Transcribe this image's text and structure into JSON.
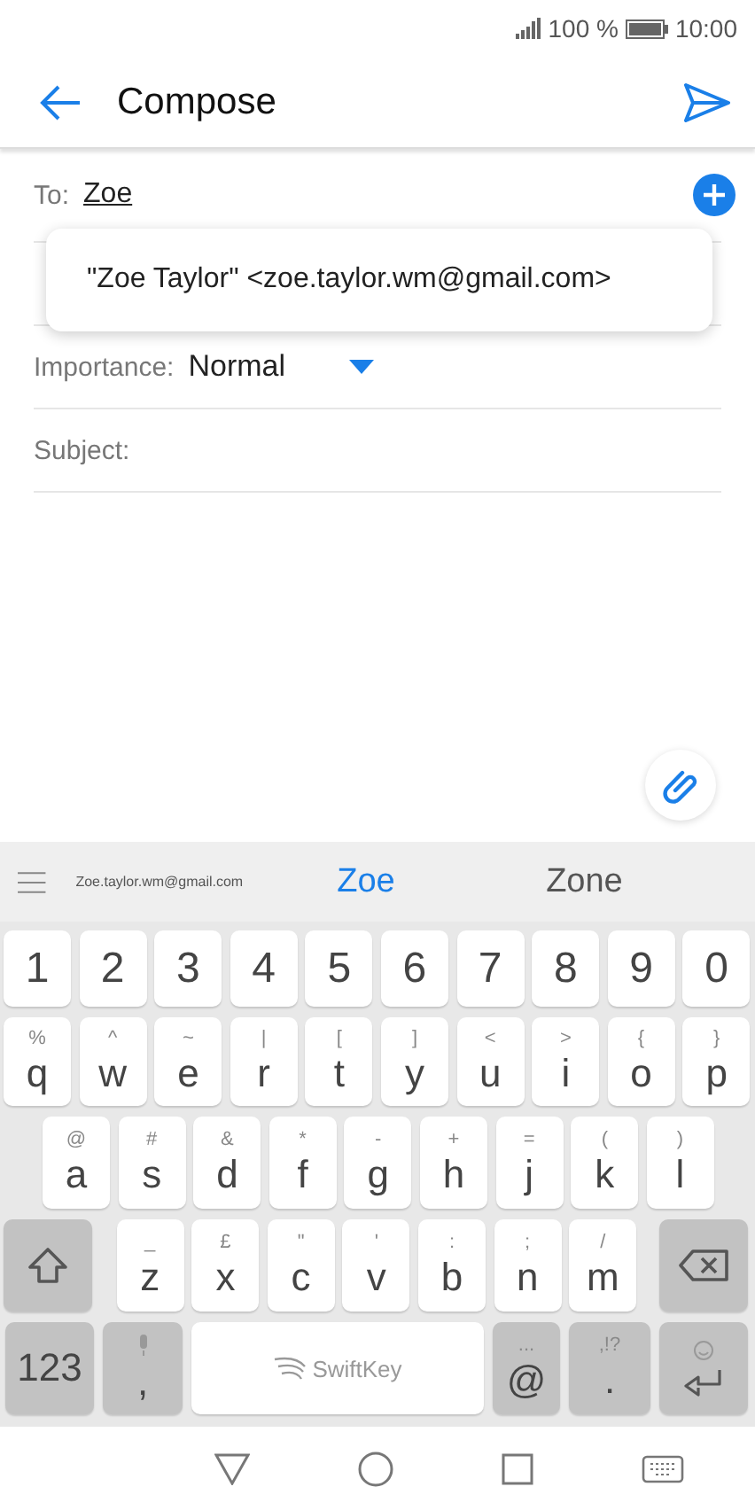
{
  "status_bar": {
    "battery": "100 %",
    "time": "10:00"
  },
  "app_bar": {
    "title": "Compose"
  },
  "to_field": {
    "label": "To:",
    "value": "Zoe"
  },
  "suggestion_popup": {
    "text": "\"Zoe Taylor\" <zoe.taylor.wm@gmail.com>"
  },
  "importance": {
    "label": "Importance:",
    "value": "Normal"
  },
  "subject": {
    "label": "Subject:"
  },
  "keyboard": {
    "suggestions": [
      {
        "text": "Zoe.taylor.wm@gmail.com",
        "kind": "small",
        "selected": false
      },
      {
        "text": "Zoe",
        "kind": "word",
        "selected": true
      },
      {
        "text": "Zone",
        "kind": "word",
        "selected": false
      }
    ],
    "rows": [
      {
        "keys": [
          {
            "kind": "char",
            "label": "1"
          },
          {
            "kind": "char",
            "label": "2"
          },
          {
            "kind": "char",
            "label": "3"
          },
          {
            "kind": "char",
            "label": "4"
          },
          {
            "kind": "char",
            "label": "5"
          },
          {
            "kind": "char",
            "label": "6"
          },
          {
            "kind": "char",
            "label": "7"
          },
          {
            "kind": "char",
            "label": "8"
          },
          {
            "kind": "char",
            "label": "9"
          },
          {
            "kind": "char",
            "label": "0"
          }
        ]
      },
      {
        "keys": [
          {
            "kind": "char",
            "label": "q",
            "hint": "%"
          },
          {
            "kind": "char",
            "label": "w",
            "hint": "^"
          },
          {
            "kind": "char",
            "label": "e",
            "hint": "~"
          },
          {
            "kind": "char",
            "label": "r",
            "hint": "|"
          },
          {
            "kind": "char",
            "label": "t",
            "hint": "["
          },
          {
            "kind": "char",
            "label": "y",
            "hint": "]"
          },
          {
            "kind": "char",
            "label": "u",
            "hint": "<"
          },
          {
            "kind": "char",
            "label": "i",
            "hint": ">"
          },
          {
            "kind": "char",
            "label": "o",
            "hint": "{"
          },
          {
            "kind": "char",
            "label": "p",
            "hint": "}"
          }
        ]
      },
      {
        "keys": [
          {
            "kind": "char",
            "label": "a",
            "hint": "@"
          },
          {
            "kind": "char",
            "label": "s",
            "hint": "#"
          },
          {
            "kind": "char",
            "label": "d",
            "hint": "&"
          },
          {
            "kind": "char",
            "label": "f",
            "hint": "*"
          },
          {
            "kind": "char",
            "label": "g",
            "hint": "-"
          },
          {
            "kind": "char",
            "label": "h",
            "hint": "+"
          },
          {
            "kind": "char",
            "label": "j",
            "hint": "="
          },
          {
            "kind": "char",
            "label": "k",
            "hint": "("
          },
          {
            "kind": "char",
            "label": "l",
            "hint": ")"
          }
        ]
      },
      {
        "keys": [
          {
            "kind": "shift"
          },
          {
            "kind": "char",
            "label": "z",
            "hint": "_"
          },
          {
            "kind": "char",
            "label": "x",
            "hint": "£"
          },
          {
            "kind": "char",
            "label": "c",
            "hint": "\""
          },
          {
            "kind": "char",
            "label": "v",
            "hint": "'"
          },
          {
            "kind": "char",
            "label": "b",
            "hint": ":"
          },
          {
            "kind": "char",
            "label": "n",
            "hint": ";"
          },
          {
            "kind": "char",
            "label": "m",
            "hint": "/"
          },
          {
            "kind": "backspace"
          }
        ]
      },
      {
        "keys": [
          {
            "kind": "mode",
            "label": "123"
          },
          {
            "kind": "mic",
            "label": ","
          },
          {
            "kind": "space",
            "label": "SwiftKey"
          },
          {
            "kind": "alt",
            "label": "@",
            "hint": "..."
          },
          {
            "kind": "alt",
            "label": ".",
            "hint": ",!?"
          },
          {
            "kind": "enter"
          }
        ]
      }
    ]
  }
}
